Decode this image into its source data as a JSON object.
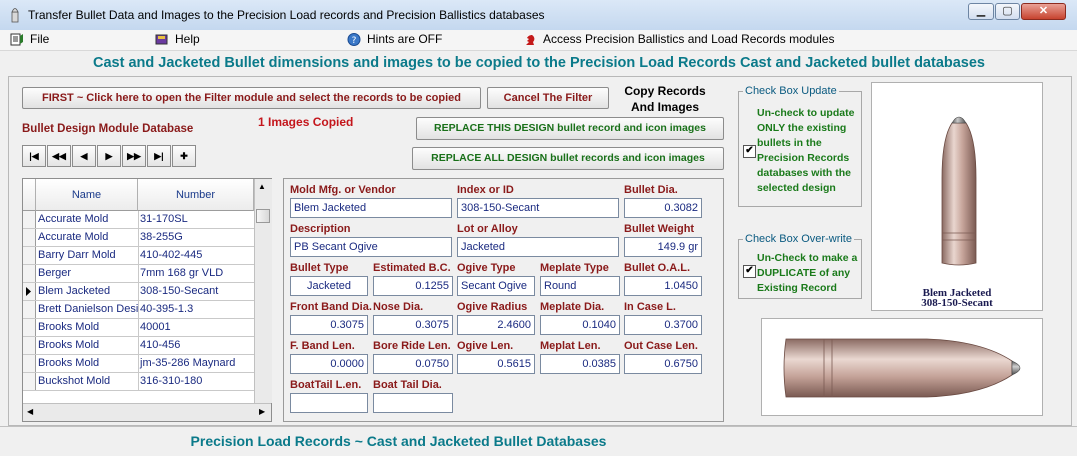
{
  "window": {
    "title": "Transfer Bullet Data and Images to the Precision Load records and Precision Ballistics databases"
  },
  "menu": {
    "file": "File",
    "help": "Help",
    "hints": "Hints are OFF",
    "access": "Access Precision Ballistics and Load Records modules"
  },
  "header": {
    "title": "Cast and Jacketed Bullet dimensions and images to be copied to the Precision Load Records Cast and Jacketed bullet databases"
  },
  "toolbar": {
    "first_button": "FIRST ~  Click here to open the Filter module and select the records to be copied",
    "cancel_filter": "Cancel  The Filter",
    "copy_records_line1": "Copy Records",
    "copy_records_line2": "And Images",
    "images_copied": "1 Images Copied",
    "replace_this": "REPLACE THIS DESIGN bullet record and icon images",
    "replace_all": "REPLACE ALL DESIGN bullet records and icon images"
  },
  "database": {
    "label": "Bullet Design Module Database",
    "nav": [
      "|◀",
      "◀◀",
      "◀",
      "▶",
      "▶▶",
      "▶|",
      "✚"
    ]
  },
  "grid": {
    "headers": {
      "name": "Name",
      "number": "Number"
    },
    "current_row": 5,
    "rows": [
      {
        "name": "Accurate Mold",
        "number": "31-170SL"
      },
      {
        "name": "Accurate Mold",
        "number": "38-255G"
      },
      {
        "name": "Barry Darr Mold",
        "number": "410-402-445"
      },
      {
        "name": "Berger",
        "number": "7mm 168 gr VLD"
      },
      {
        "name": "Blem Jacketed",
        "number": "308-150-Secant"
      },
      {
        "name": "Brett Danielson Design",
        "number": "40-395-1.3"
      },
      {
        "name": "Brooks Mold",
        "number": "40001"
      },
      {
        "name": "Brooks Mold",
        "number": "410-456"
      },
      {
        "name": "Brooks Mold",
        "number": "jm-35-286 Maynard"
      },
      {
        "name": "Buckshot Mold",
        "number": "316-310-180"
      }
    ]
  },
  "fields": {
    "mold_label": "Mold Mfg. or Vendor",
    "mold_value": "Blem Jacketed",
    "index_label": "Index or ID",
    "index_value": "308-150-Secant",
    "dia_label": "Bullet Dia.",
    "dia_value": "0.3082",
    "desc_label": "Description",
    "desc_value": "PB Secant Ogive",
    "lot_label": "Lot or Alloy",
    "lot_value": "Jacketed",
    "weight_label": "Bullet Weight",
    "weight_value": "149.9 gr",
    "type_label": "Bullet Type",
    "type_value": "Jacketed",
    "bc_label": "Estimated B.C.",
    "bc_value": "0.1255",
    "ogive_type_label": "Ogive Type",
    "ogive_type_value": "Secant Ogive",
    "meplate_type_label": "Meplate Type",
    "meplate_type_value": "Round",
    "oal_label": "Bullet O.A.L.",
    "oal_value": "1.0450",
    "front_band_label": "Front Band Dia.",
    "front_band_value": "0.3075",
    "nose_dia_label": "Nose Dia.",
    "nose_dia_value": "0.3075",
    "ogive_radius_label": "Ogive Radius",
    "ogive_radius_value": "2.4600",
    "meplate_dia_label": "Meplate Dia.",
    "meplate_dia_value": "0.1040",
    "in_case_label": "In Case L.",
    "in_case_value": "0.3700",
    "fband_len_label": "F. Band Len.",
    "fband_len_value": "0.0000",
    "bore_ride_label": "Bore Ride Len.",
    "bore_ride_value": "0.0750",
    "ogive_len_label": "Ogive Len.",
    "ogive_len_value": "0.5615",
    "meplat_len_label": "Meplat Len.",
    "meplat_len_value": "0.0385",
    "out_case_label": "Out Case Len.",
    "out_case_value": "0.6750",
    "boattail_len_label": "BoatTail L.en.",
    "boattail_len_value": "",
    "boattail_dia_label": "Boat Tail Dia.",
    "boattail_dia_value": ""
  },
  "checkbox_update": {
    "title": "Check Box Update",
    "lines": [
      "Un-check to update",
      "ONLY the existing",
      "bullets in the",
      "Precision Records",
      "databases with the",
      "selected design"
    ],
    "checked": "✔"
  },
  "checkbox_overwrite": {
    "title": "Check Box Over-write",
    "lines": [
      "Un-Check to make a",
      "DUPLICATE of any",
      "Existing Record"
    ],
    "checked": "✔"
  },
  "image": {
    "caption1": "Blem Jacketed",
    "caption2": "308-150-Secant"
  },
  "footer": {
    "title": "Precision Load Records  ~   Cast and Jacketed Bullet Databases"
  }
}
